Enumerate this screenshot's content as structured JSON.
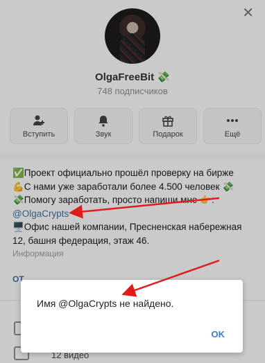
{
  "channel": {
    "name": "OlgaFreeBit",
    "name_emoji": "💸",
    "subscribers": "748 подписчиков"
  },
  "actions": [
    {
      "label": "Вступить",
      "icon": "add-user-icon"
    },
    {
      "label": "Звук",
      "icon": "bell-icon"
    },
    {
      "label": "Подарок",
      "icon": "gift-icon"
    },
    {
      "label": "Ещё",
      "icon": "more-icon"
    }
  ],
  "description": {
    "line1": "✅Проект официально прошёл проверку на бирже",
    "line2": "💪С нами уже заработали более 4.500 человек 💸",
    "line3": "💸Помогу заработать, просто напиши мне 👉:",
    "link": "@OlgaCrypts",
    "line4": "🖥️Офис нашей компании, Пресненская набережная",
    "line5": "12, башня федерация, этаж 46.",
    "info_label": "Информация"
  },
  "truncated_link": "ОТ",
  "list": {
    "video_count": "12 видео"
  },
  "dialog": {
    "message": "Имя @OlgaCrypts не найдено.",
    "ok": "OK"
  },
  "colors": {
    "link": "#3a6fa0",
    "accent": "#3a7fc1",
    "arrow": "#e01b1b"
  }
}
